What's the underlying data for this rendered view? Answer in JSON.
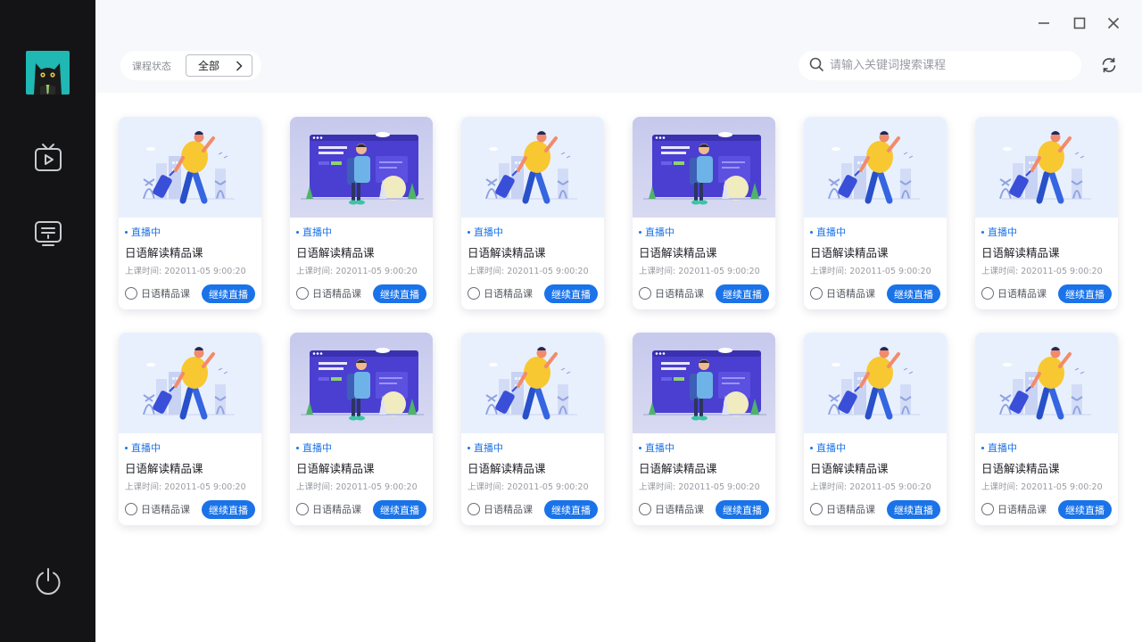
{
  "header": {
    "filter_label": "课程状态",
    "filter_value": "全部",
    "search_placeholder": "请输入关键词搜索课程"
  },
  "sidebar": {
    "items": [
      {
        "icon": "tv-play-icon"
      },
      {
        "icon": "screen-course-icon"
      }
    ],
    "logout_icon": "power-icon"
  },
  "colors": {
    "accent": "#1a73e8",
    "sidebar_bg": "#141416",
    "topbar_bg": "#f6f8fb"
  },
  "courses": [
    {
      "status": "直播中",
      "title": "日语解读精品课",
      "time": "上课时间: 202011-05  9:00:20",
      "tag": "日语精品课",
      "action": "继续直播",
      "thumb": "light"
    },
    {
      "status": "直播中",
      "title": "日语解读精品课",
      "time": "上课时间: 202011-05  9:00:20",
      "tag": "日语精品课",
      "action": "继续直播",
      "thumb": "dark"
    },
    {
      "status": "直播中",
      "title": "日语解读精品课",
      "time": "上课时间: 202011-05  9:00:20",
      "tag": "日语精品课",
      "action": "继续直播",
      "thumb": "light"
    },
    {
      "status": "直播中",
      "title": "日语解读精品课",
      "time": "上课时间: 202011-05  9:00:20",
      "tag": "日语精品课",
      "action": "继续直播",
      "thumb": "dark"
    },
    {
      "status": "直播中",
      "title": "日语解读精品课",
      "time": "上课时间: 202011-05  9:00:20",
      "tag": "日语精品课",
      "action": "继续直播",
      "thumb": "light"
    },
    {
      "status": "直播中",
      "title": "日语解读精品课",
      "time": "上课时间: 202011-05  9:00:20",
      "tag": "日语精品课",
      "action": "继续直播",
      "thumb": "light"
    },
    {
      "status": "直播中",
      "title": "日语解读精品课",
      "time": "上课时间: 202011-05  9:00:20",
      "tag": "日语精品课",
      "action": "继续直播",
      "thumb": "light"
    },
    {
      "status": "直播中",
      "title": "日语解读精品课",
      "time": "上课时间: 202011-05  9:00:20",
      "tag": "日语精品课",
      "action": "继续直播",
      "thumb": "dark"
    },
    {
      "status": "直播中",
      "title": "日语解读精品课",
      "time": "上课时间: 202011-05  9:00:20",
      "tag": "日语精品课",
      "action": "继续直播",
      "thumb": "light"
    },
    {
      "status": "直播中",
      "title": "日语解读精品课",
      "time": "上课时间: 202011-05  9:00:20",
      "tag": "日语精品课",
      "action": "继续直播",
      "thumb": "dark"
    },
    {
      "status": "直播中",
      "title": "日语解读精品课",
      "time": "上课时间: 202011-05  9:00:20",
      "tag": "日语精品课",
      "action": "继续直播",
      "thumb": "light"
    },
    {
      "status": "直播中",
      "title": "日语解读精品课",
      "time": "上课时间: 202011-05  9:00:20",
      "tag": "日语精品课",
      "action": "继续直播",
      "thumb": "light"
    }
  ]
}
